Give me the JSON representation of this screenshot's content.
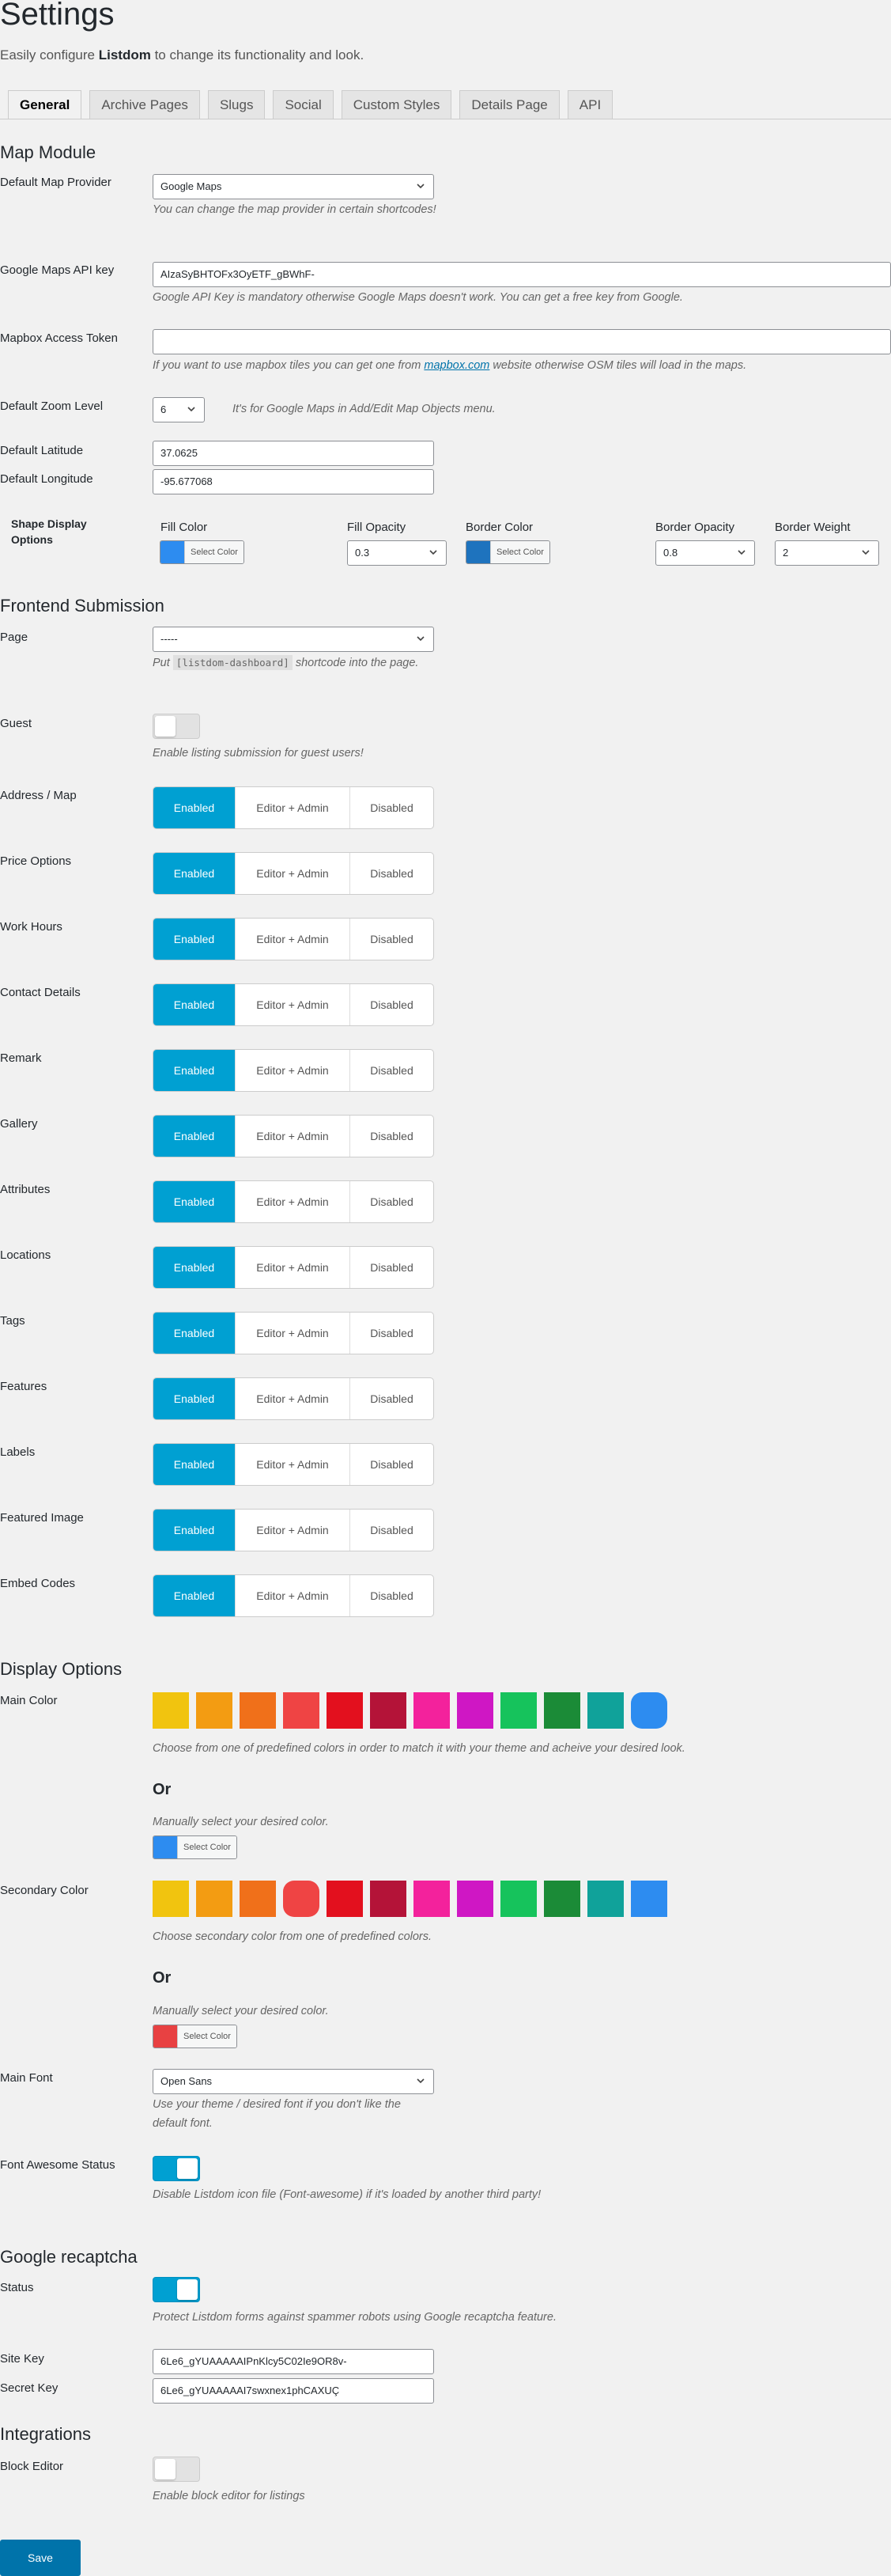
{
  "page": {
    "title": "Settings",
    "subtitle_prefix": "Easily configure ",
    "subtitle_brand": "Listdom",
    "subtitle_suffix": " to change its functionality and look."
  },
  "tabs": [
    {
      "label": "General"
    },
    {
      "label": "Archive Pages"
    },
    {
      "label": "Slugs"
    },
    {
      "label": "Social"
    },
    {
      "label": "Custom Styles"
    },
    {
      "label": "Details Page"
    },
    {
      "label": "API"
    }
  ],
  "map_module": {
    "title": "Map Module",
    "provider_label": "Default Map Provider",
    "provider_value": "Google Maps",
    "provider_help": "You can change the map provider in certain shortcodes!",
    "api_key_label": "Google Maps API key",
    "api_key_value": "AIzaSyBHTOFx3OyETF_gBWhF-",
    "api_key_help": "Google API Key is mandatory otherwise Google Maps doesn't work. You can get a free key from Google.",
    "mapbox_label": "Mapbox Access Token",
    "mapbox_value": "",
    "mapbox_help_prefix": "If you want to use mapbox tiles you can get one from ",
    "mapbox_help_link": "mapbox.com",
    "mapbox_help_suffix": " website otherwise OSM tiles will load in the maps.",
    "zoom_label": "Default Zoom Level",
    "zoom_value": "6",
    "zoom_help": "It's for Google Maps in Add/Edit Map Objects menu.",
    "lat_label": "Default Latitude",
    "lat_value": "37.0625",
    "lng_label": "Default Longitude",
    "lng_value": "-95.677068",
    "shape_label": "Shape Display Options",
    "fill_color_label": "Fill Color",
    "fill_color_btn": "Select Color",
    "fill_color": "#2d8cf0",
    "fill_opacity_label": "Fill Opacity",
    "fill_opacity_value": "0.3",
    "border_color_label": "Border Color",
    "border_color_btn": "Select Color",
    "border_color": "#1e73be",
    "border_opacity_label": "Border Opacity",
    "border_opacity_value": "0.8",
    "border_weight_label": "Border Weight",
    "border_weight_value": "2"
  },
  "frontend": {
    "title": "Frontend Submission",
    "page_label": "Page",
    "page_value": "-----",
    "page_help_prefix": "Put ",
    "page_help_code": "[listdom-dashboard]",
    "page_help_suffix": " shortcode into the page.",
    "guest_label": "Guest",
    "guest_help": "Enable listing submission for guest users!",
    "opt_enabled": "Enabled",
    "opt_editor": "Editor + Admin",
    "opt_disabled": "Disabled",
    "fields": [
      {
        "label": "Address / Map"
      },
      {
        "label": "Price Options"
      },
      {
        "label": "Work Hours"
      },
      {
        "label": "Contact Details"
      },
      {
        "label": "Remark"
      },
      {
        "label": "Gallery"
      },
      {
        "label": "Attributes"
      },
      {
        "label": "Locations"
      },
      {
        "label": "Tags"
      },
      {
        "label": "Features"
      },
      {
        "label": "Labels"
      },
      {
        "label": "Featured Image"
      },
      {
        "label": "Embed Codes"
      }
    ]
  },
  "display": {
    "title": "Display Options",
    "main_color_label": "Main Color",
    "main_help": "Choose from one of predefined colors in order to match it with your theme and acheive your desired look.",
    "or_label": "Or",
    "manual_help": "Manually select your desired color.",
    "main_picker_btn": "Select Color",
    "main_picker_color": "#2d8cf0",
    "secondary_label": "Secondary Color",
    "secondary_help": "Choose secondary color from one of predefined colors.",
    "secondary_picker_btn": "Select Color",
    "secondary_picker_color": "#e84142",
    "palette": [
      "#f1c40f",
      "#f39c12",
      "#f0701a",
      "#ef4444",
      "#e3101e",
      "#b41338",
      "#f3229c",
      "#cf17c4",
      "#16c35c",
      "#1b8b37",
      "#10a29a",
      "#2d8cf0"
    ],
    "main_selected_index": 11,
    "secondary_selected_index": 3,
    "font_label": "Main Font",
    "font_value": "Open Sans",
    "font_help": "Use your theme / desired font if you don't like the default font.",
    "fa_label": "Font Awesome Status",
    "fa_help": "Disable Listdom icon file (Font-awesome) if it's loaded by another third party!"
  },
  "recaptcha": {
    "title": "Google recaptcha",
    "status_label": "Status",
    "status_help": "Protect Listdom forms against spammer robots using Google recaptcha feature.",
    "site_key_label": "Site Key",
    "site_key_value": "6Le6_gYUAAAAAIPnKlcy5C02Ie9OR8v-",
    "secret_key_label": "Secret Key",
    "secret_key_value": "6Le6_gYUAAAAAI7swxnex1phCAXUÇ"
  },
  "integrations": {
    "title": "Integrations",
    "block_label": "Block Editor",
    "block_help": "Enable block editor for listings"
  },
  "save_label": "Save"
}
